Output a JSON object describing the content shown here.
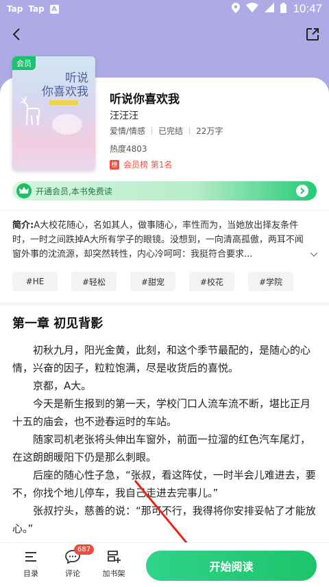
{
  "status_bar": {
    "app1": "Tap",
    "app2": "Tap",
    "app3": "A",
    "time": "10:47"
  },
  "book": {
    "cover_badge": "会员",
    "cover_title_line1": "听说",
    "cover_title_line2": "你喜欢我",
    "title": "听说你喜欢我",
    "author": "汪汪汪",
    "category": "爱情/情感",
    "status": "已完结",
    "word_count": "22万字",
    "heat": "热度4803",
    "rank_icon": "榜",
    "rank_text": "会员榜 第1名"
  },
  "vip_bar": {
    "text": "开通会员,本书免费读"
  },
  "intro": {
    "label": "简介:",
    "text": "A大校花随心，名如其人，做事随心，率性而为，当她放出择友条件时，一时之间跌掉A大所有学子的眼镜。没想到，一向清高孤傲，两耳不闻窗外事的沈流源，却突然转性，内心冷呵呵：我挺符合要求..."
  },
  "tags": [
    "#HE",
    "#轻松",
    "#甜宠",
    "#校花",
    "#学院"
  ],
  "chapter": {
    "title": "第一章 初见背影",
    "paragraphs": [
      "初秋九月，阳光金黄，此刻，和这个季节最配的，是随心的心情，兴奋的因子，粒粒饱满，尽是收货后的喜悦。",
      "京都，A大。",
      "今天是新生报到的第一天，学校门口人流车流不断，堪比正月十五的庙会，也不逊春运时的车站。",
      "随家司机老张将头伸出车窗外，前面一拉溜的红色汽车尾灯，在这朗朗暖阳下仍是那么刺眼。",
      "后座的随心性子急，“张叔，看这阵仗，一时半会儿难进去，要不，你找个地儿停车，我自己走进去完事儿。”",
      "张叔拧头，慈善的说：“那可不行，我得将你安排妥帖了才能放心。”"
    ]
  },
  "bottom_bar": {
    "catalog_label": "目录",
    "comment_label": "评论",
    "comment_count": "687",
    "shelf_label": "加书架",
    "start_label": "开始阅读"
  },
  "colors": {
    "accent": "#1dc46b",
    "header_bg": "#aeaae6",
    "rank_red": "#f0503e"
  }
}
